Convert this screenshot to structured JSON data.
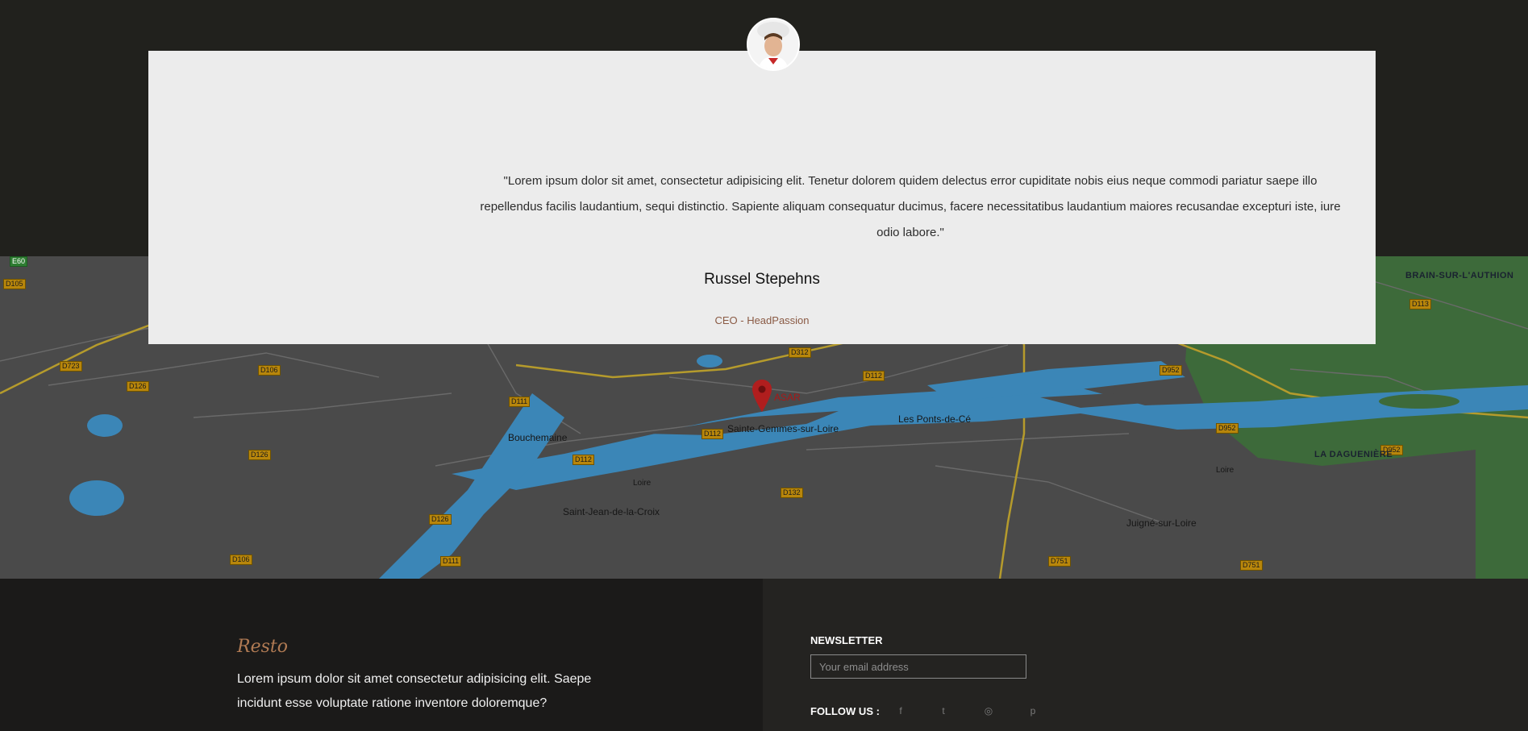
{
  "testimonial": {
    "quote": "\"Lorem ipsum dolor sit amet, consectetur adipisicing elit. Tenetur dolorem quidem delectus error cupiditate nobis eius neque commodi pariatur saepe illo repellendus facilis laudantium, sequi distinctio. Sapiente aliquam consequatur ducimus, facere necessitatibus laudantium maiores recusandae excepturi iste, iure odio labore.\"",
    "author": "Russel Stepehns",
    "role": "CEO - HeadPassion"
  },
  "map": {
    "marker_label": "ASAR",
    "places": [
      "Bouchemaine",
      "Sainte-Gemmes-sur-Loire",
      "Les Ponts-de-Cé",
      "Saint-Jean-de-la-Croix",
      "Juigné-sur-Loire",
      "BRAIN-SUR-L'AUTHION",
      "LA DAGUENIÈRE",
      "Loire"
    ],
    "roads": [
      "E60",
      "D105",
      "D723",
      "D106",
      "D126",
      "D111",
      "D112",
      "D312",
      "D952",
      "D113",
      "D132",
      "D751"
    ]
  },
  "footer": {
    "logo": "Resto",
    "about": "Lorem ipsum dolor sit amet consectetur adipisicing elit. Saepe incidunt esse voluptate ratione inventore doloremque?",
    "newsletter_title": "NEWSLETTER",
    "email_placeholder": "Your email address",
    "follow_label": "FOLLOW US :",
    "social": [
      {
        "name": "facebook-icon",
        "glyph": "f"
      },
      {
        "name": "twitter-icon",
        "glyph": "t"
      },
      {
        "name": "instagram-icon",
        "glyph": "◎"
      },
      {
        "name": "pinterest-icon",
        "glyph": "p"
      }
    ]
  }
}
